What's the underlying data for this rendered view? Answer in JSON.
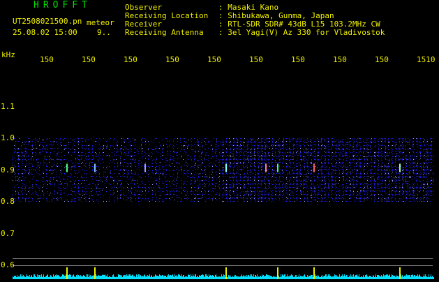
{
  "header": {
    "app_name": "HROFFT",
    "file_name": "UT2508021500.pn",
    "mode": "meteor",
    "date_time": "25.08.02 15:00",
    "count": "9..",
    "fields": [
      {
        "label": "Observer",
        "value": ": Masaki Kano"
      },
      {
        "label": "Receiving Location",
        "value": ": Shibukawa, Gunma, Japan"
      },
      {
        "label": "Receiver",
        "value": ": RTL-SDR SDR# 43dB L15 103.2MHz CW"
      },
      {
        "label": "Receiving Antenna",
        "value": ": 3el Yagi(V) Az 330 for Vladivostok"
      }
    ]
  },
  "chart_data": {
    "type": "heatmap",
    "ylabel": "kHz",
    "y_ticks": [
      "1.1",
      "1.0",
      "0.9",
      "0.8",
      "0.7",
      "0.6"
    ],
    "x_ticks": [
      "150",
      "150",
      "150",
      "150",
      "150",
      "150",
      "150",
      "150",
      "150",
      "1510"
    ],
    "ylim": [
      0.6,
      1.15
    ],
    "band": [
      0.8,
      1.0
    ],
    "colors": {
      "noise": "#2020ff",
      "bright": "#a0a0ff",
      "spectrum": "#00e0ff",
      "tick": "#f0f000",
      "axis": "#f0f000"
    }
  }
}
